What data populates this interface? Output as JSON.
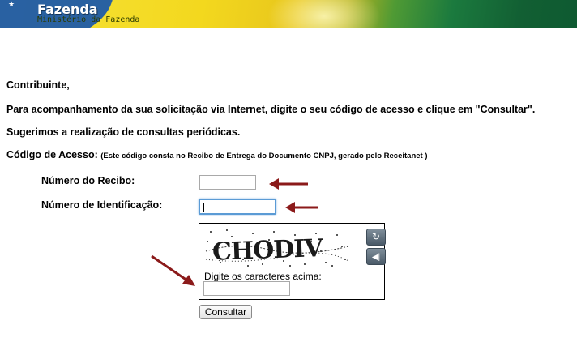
{
  "header": {
    "title": "Fazenda",
    "subtitle": "Ministério da Fazenda"
  },
  "intro": {
    "greeting": "Contribuinte,",
    "instruction": "Para acompanhamento da sua solicitação via Internet, digite o seu código de acesso e clique em \"Consultar\".",
    "suggestion": "Sugerimos a realização de consultas periódicas.",
    "code_label": "Código de Acesso:",
    "code_note": "(Este código consta no Recibo de Entrega do Documento CNPJ, gerado pelo Receitanet )"
  },
  "form": {
    "receipt_label": "Número do Recibo:",
    "receipt_value": "",
    "id_label": "Número de Identificação:",
    "id_value": ""
  },
  "captcha": {
    "text": "CHODIV",
    "prompt": "Digite os caracteres acima:",
    "value": "",
    "refresh_icon": "refresh-icon",
    "audio_icon": "speaker-icon"
  },
  "actions": {
    "submit_label": "Consultar"
  },
  "colors": {
    "arrow": "#8b1a1a",
    "focus": "#5b9bd5",
    "banner_yellow": "#f3d81e",
    "banner_green": "#125f33"
  }
}
